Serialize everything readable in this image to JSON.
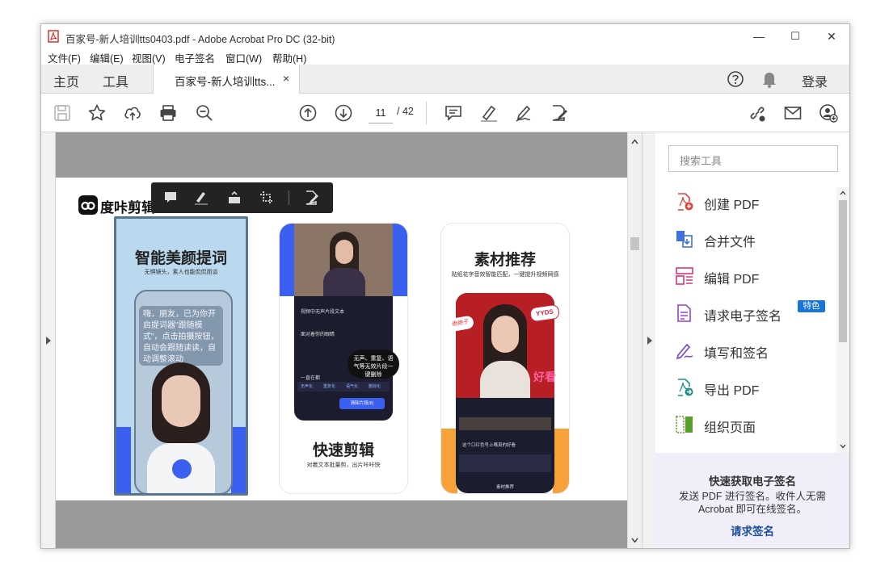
{
  "window": {
    "title": "百家号-新人培训tts0403.pdf - Adobe Acrobat Pro DC (32-bit)",
    "controls": {
      "minimize": "—",
      "maximize": "☐",
      "close": "✕"
    }
  },
  "menu": [
    "文件(F)",
    "编辑(E)",
    "视图(V)",
    "电子签名",
    "窗口(W)",
    "帮助(H)"
  ],
  "tabs": {
    "home": "主页",
    "tools": "工具",
    "document": "百家号-新人培训tts...",
    "close": "×",
    "login": "登录"
  },
  "toolbar": {
    "current_page": "11",
    "total_pages": "/ 42"
  },
  "page_content": {
    "logo_text": "度咔剪辑",
    "panel1": {
      "title": "智能美颜提词",
      "subtitle": "无惧镜头，素人也能侃侃而谈",
      "prompter_text": "嗨，朋友，已为你开启提词器\"跟随模式\"，点击拍摄按钮，自动会跟随读读，自动调整滚动"
    },
    "panel2": {
      "title": "快速剪辑",
      "subtitle": "对着文本批量剪，出片咔咔快",
      "bubble": "无声、重复、语气等无效片段一键删除",
      "rows": [
        "视频中无声片段文本",
        "面对着你的眼睛",
        "一直在都"
      ],
      "tags": [
        "无声化",
        "重复化",
        "语气化",
        "删除化"
      ],
      "button": "清除片段(6)"
    },
    "panel3": {
      "title": "素材推荐",
      "subtitle": "贴纸花字音效智能匹配，一键提升视频网感",
      "sticker1": "YYDS",
      "sticker2": "好看",
      "sticker3": "绝绝子",
      "caption": "这个口红色号上嘴真的好看",
      "bottom": "素材推荐"
    }
  },
  "right_pane": {
    "search_placeholder": "搜索工具",
    "tools": [
      {
        "label": "创建 PDF",
        "icon": "create-pdf-icon",
        "color": "#e0443e"
      },
      {
        "label": "合并文件",
        "icon": "combine-files-icon",
        "color": "#3f6fe0"
      },
      {
        "label": "编辑 PDF",
        "icon": "edit-pdf-icon",
        "color": "#d8357b"
      },
      {
        "label": "请求电子签名",
        "icon": "request-signature-icon",
        "color": "#9c3fd6"
      },
      {
        "label": "填写和签名",
        "icon": "fill-sign-icon",
        "color": "#7a48c9"
      },
      {
        "label": "导出 PDF",
        "icon": "export-pdf-icon",
        "color": "#1f8f86"
      },
      {
        "label": "组织页面",
        "icon": "organize-pages-icon",
        "color": "#5a9e2e"
      }
    ],
    "badge": "特色",
    "promo": {
      "title": "快速获取电子签名",
      "line1": "发送 PDF 进行签名。收件人无需",
      "line2": "Acrobat 即可在线签名。",
      "link": "请求签名"
    }
  },
  "colors": {
    "accent_blue": "#1a73d9",
    "promo_bg": "#f1eef9",
    "panel_blue": "#3b5ff0",
    "panel_orange": "#f6a13a"
  }
}
